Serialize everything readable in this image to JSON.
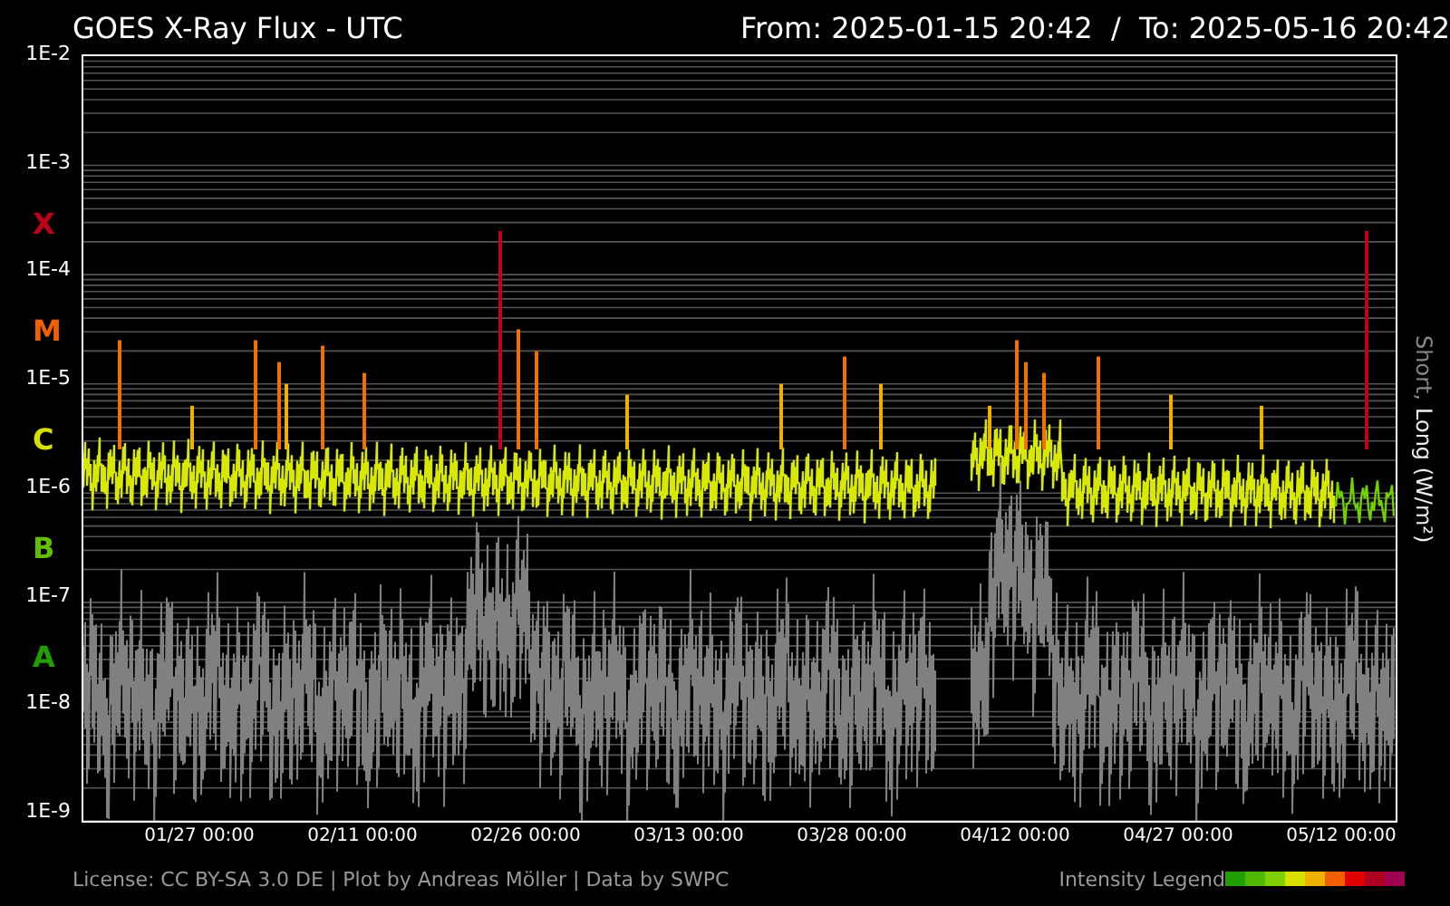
{
  "header": {
    "title": "GOES X-Ray Flux - UTC",
    "range": "From: 2025-01-15 20:42  /  To: 2025-05-16 20:42"
  },
  "y_axis": {
    "decades": [
      {
        "label": "1E-2"
      },
      {
        "label": "1E-3",
        "class_label": "X",
        "color": "#c00018"
      },
      {
        "label": "1E-4",
        "class_label": "M",
        "color": "#f06000"
      },
      {
        "label": "1E-5",
        "class_label": "C",
        "color": "#d8e000"
      },
      {
        "label": "1E-6",
        "class_label": "B",
        "color": "#60c000"
      },
      {
        "label": "1E-7",
        "class_label": "A",
        "color": "#20a000"
      },
      {
        "label": "1E-8"
      }
    ],
    "bottom_label": "1E-9"
  },
  "right_axis": {
    "short": "Short,",
    "long": "Long (W/m²)"
  },
  "x_axis": {
    "ticks": [
      "01/27 00:00",
      "02/11 00:00",
      "02/26 00:00",
      "03/13 00:00",
      "03/28 00:00",
      "04/12 00:00",
      "04/27 00:00",
      "05/12 00:00"
    ]
  },
  "footer": {
    "credits": "License: CC BY-SA 3.0 DE | Plot by Andreas Möller | Data by SWPC",
    "legend_label": "Intensity Legend",
    "legend_swatches": [
      {
        "color": "#20a000"
      },
      {
        "color": "#50b800"
      },
      {
        "color": "#80d000"
      },
      {
        "color": "#d8e000"
      },
      {
        "color": "#f0b000"
      },
      {
        "color": "#f06000"
      },
      {
        "color": "#e00000"
      },
      {
        "color": "#b00020"
      },
      {
        "color": "#a00050"
      }
    ]
  }
}
